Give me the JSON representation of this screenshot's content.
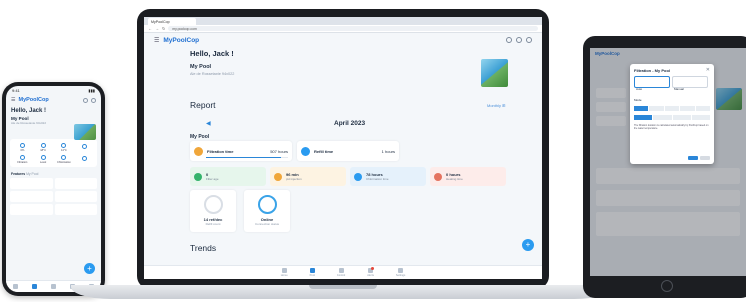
{
  "brand": {
    "name": "MyPoolCop",
    "accent": "#1f6fd1",
    "action": "#2a9bf0"
  },
  "phone": {
    "greeting": "Hello, Jack !",
    "pool_name": "My Pool",
    "address": "Ale de Rossetaxte 94x022",
    "tiles": [
      {
        "icon": "water-icon",
        "value": "0%"
      },
      {
        "icon": "thermometer-icon",
        "value": "18°C"
      },
      {
        "icon": "thermometer-icon",
        "value": "14°C"
      },
      {
        "icon": "sun-icon",
        "value": ""
      },
      {
        "icon": "filter-icon",
        "value": "Filtration"
      },
      {
        "icon": "level-icon",
        "value": "Level"
      },
      {
        "icon": "drop-icon",
        "value": "Chlorination"
      },
      {
        "icon": "light-icon",
        "value": ""
      }
    ],
    "section_features": "Features",
    "section_feature_title": "My Pool",
    "fab_label": "+"
  },
  "browser": {
    "tab_title": "MyPoolCop",
    "url": "my.poolcop.com"
  },
  "laptop": {
    "greeting": "Hello, Jack !",
    "pool_name": "My Pool",
    "address": "Ale de Rossetaxte 94x022",
    "report_title": "Report",
    "monthly_link": "Monthly ⊞",
    "prev_arrow": "◀",
    "month": "April 2023",
    "section_pool": "My Pool",
    "filtration": {
      "label": "Filtration time",
      "value": "507 hours",
      "progress": 0.92
    },
    "refill": {
      "label": "Refill time",
      "value": "1 hours"
    },
    "kpis": [
      {
        "value": "0",
        "caption": "Filter age",
        "bg": "#e6f6ec",
        "icon": "#34b36b"
      },
      {
        "value": "96 min",
        "caption": "pH injection",
        "bg": "#fdf3e2",
        "icon": "#f0a63a"
      },
      {
        "value": "78 hours",
        "caption": "Chlorination time",
        "bg": "#e5f1fb",
        "icon": "#2a9bf0"
      },
      {
        "value": "0 hours",
        "caption": "Heating time",
        "bg": "#fdecea",
        "icon": "#e4735f"
      }
    ],
    "gauges": [
      {
        "value": "14 ref/dec",
        "caption": "Refill count",
        "ring": "#d9dee5"
      },
      {
        "value": "Online",
        "caption": "Connection status",
        "ring": "#3aa3e8"
      }
    ],
    "trends_title": "Trends",
    "fab_label": "+",
    "nav": [
      {
        "label": "Home",
        "icon": "home-icon"
      },
      {
        "label": "Pool",
        "icon": "pool-icon",
        "active": true
      },
      {
        "label": "Control",
        "icon": "control-icon"
      },
      {
        "label": "Alerts",
        "icon": "bell-icon"
      },
      {
        "label": "Settings",
        "icon": "gear-icon"
      }
    ]
  },
  "tablet": {
    "modal_title": "Filtration - My Pool",
    "close": "✕",
    "mode_label": "Mode",
    "options": [
      "Auto",
      "Manual"
    ],
    "note": "The filtration duration is calculated automatically by PoolCop based on the water temperature."
  }
}
